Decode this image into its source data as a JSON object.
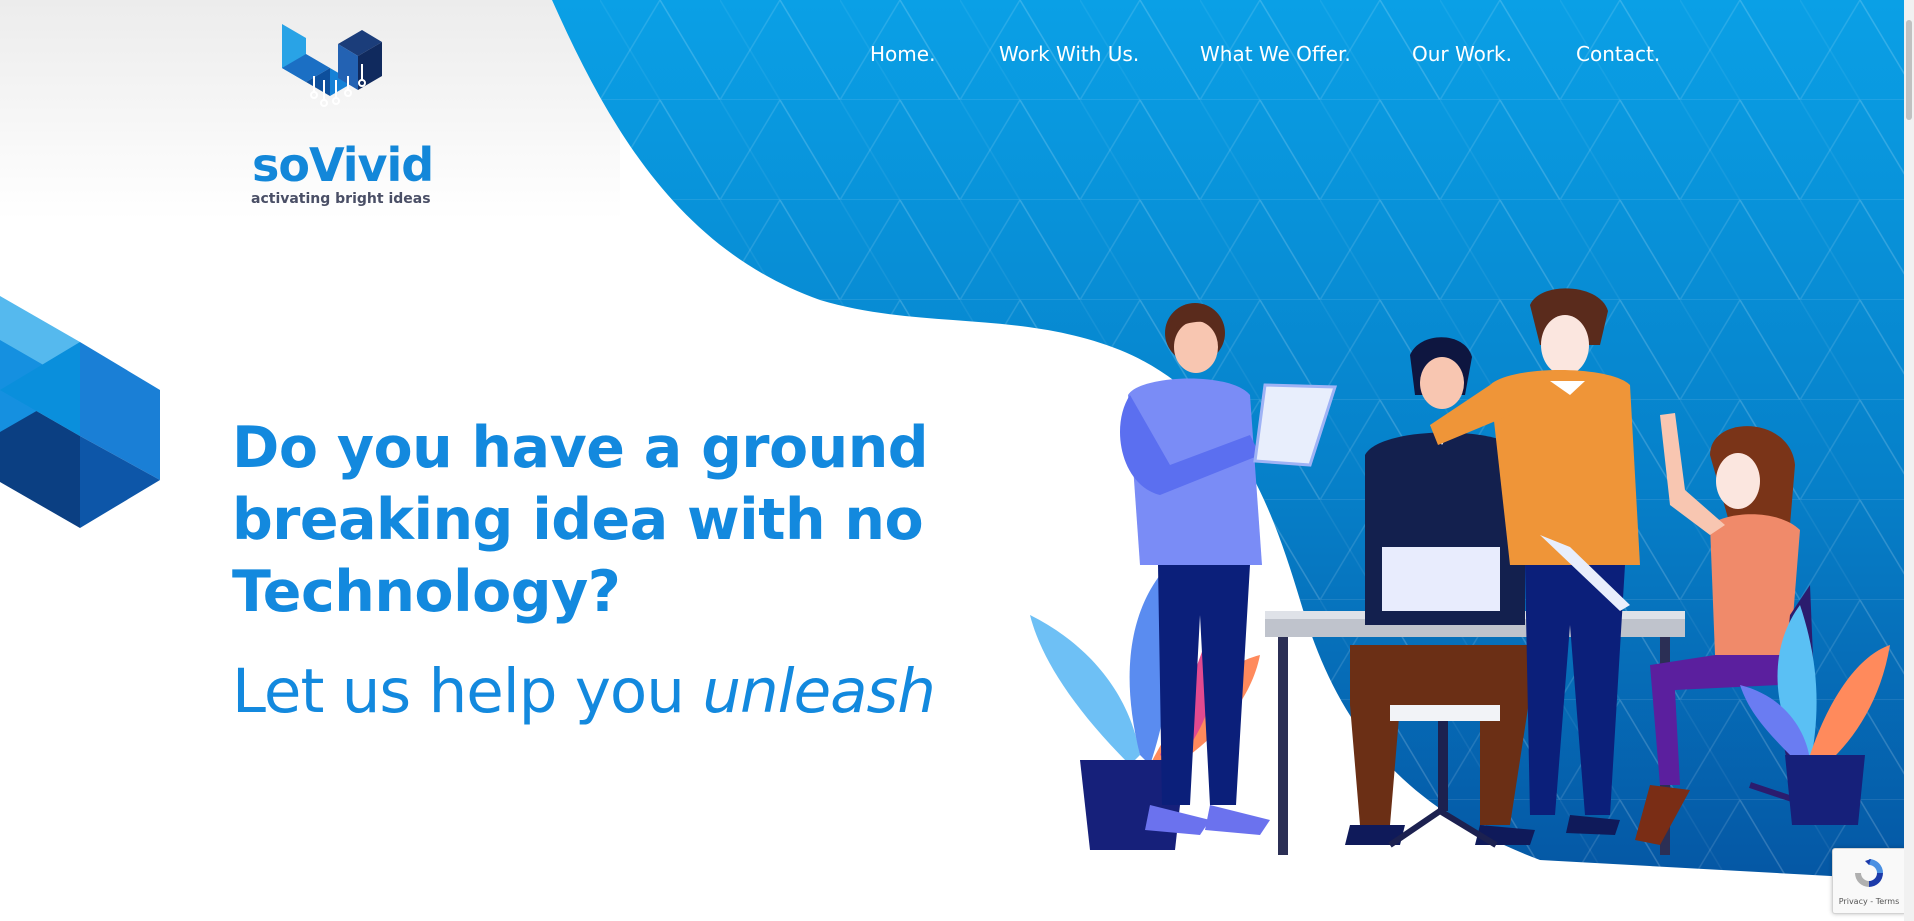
{
  "brand": {
    "name": "soVivid",
    "tagline": "activating bright ideas"
  },
  "nav": {
    "items": [
      {
        "label": "Home."
      },
      {
        "label": "Work With Us."
      },
      {
        "label": "What We Offer."
      },
      {
        "label": "Our Work."
      },
      {
        "label": "Contact."
      }
    ]
  },
  "hero": {
    "title": "Do you have a ground breaking idea with no Technology?",
    "subtitle_prefix": "Let us help you",
    "subtitle_emphasis": "unleash"
  },
  "recaptcha": {
    "links": "Privacy - Terms"
  },
  "icons": [
    "recaptcha-icon",
    "logo-mark-icon"
  ],
  "colors": {
    "accent": "#1389de",
    "hero_bg_top": "#0aa0e6",
    "hero_bg_bottom": "#0766b6",
    "brand_dark": "#1b3d7a"
  }
}
